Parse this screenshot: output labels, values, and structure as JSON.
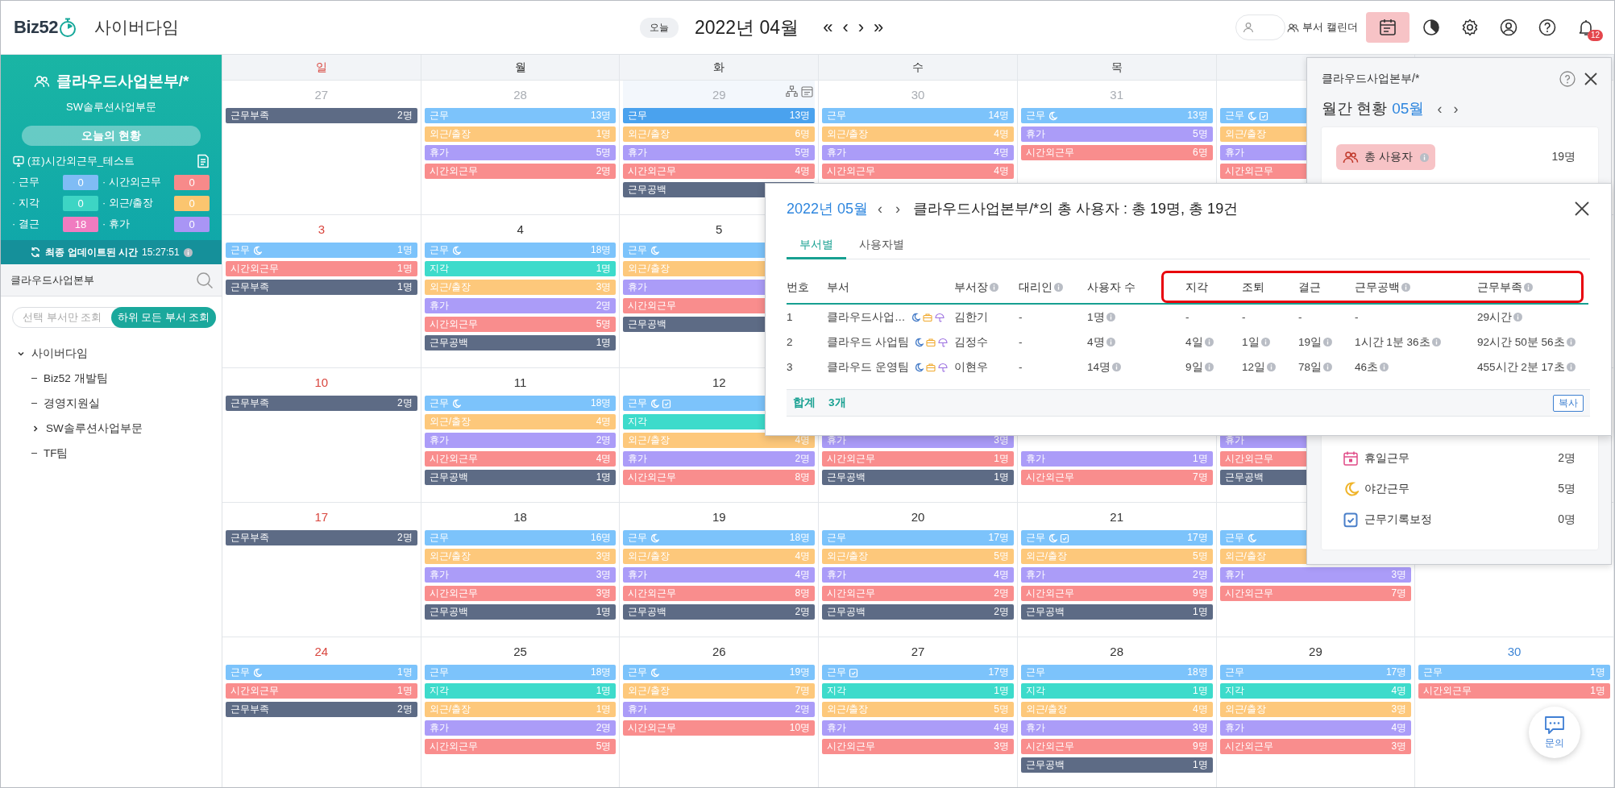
{
  "topbar": {
    "logo": "Biz52",
    "company": "사이버다임",
    "today_button": "오늘",
    "month_title": "2022년 04월",
    "nav": [
      "«",
      "‹",
      "›",
      "»"
    ],
    "calendar_toggle": "부서 캘린더",
    "tools": [
      {
        "kind": "calendar",
        "selected": true
      },
      {
        "kind": "chart",
        "selected": false
      },
      {
        "kind": "settings",
        "selected": false
      },
      {
        "kind": "account",
        "selected": false
      },
      {
        "kind": "help",
        "selected": false
      },
      {
        "kind": "notifications",
        "selected": false,
        "badge": "12"
      }
    ]
  },
  "sidebar": {
    "org_title": "클라우드사업본부/*",
    "org_subtitle": "SW솔루션사업부문",
    "today_label": "오늘의 현황",
    "report": "(표)시간외근무_테스트",
    "stats": [
      {
        "label": "· 근무",
        "value": "0",
        "color": "#7fbcf5"
      },
      {
        "label": "· 시간외근무",
        "value": "0",
        "color": "#f78a8a"
      },
      {
        "label": "· 지각",
        "value": "0",
        "color": "#3dd5c4"
      },
      {
        "label": "· 외근/출장",
        "value": "0",
        "color": "#fbc56f"
      },
      {
        "label": "· 결근",
        "value": "18",
        "color": "#f07cc0"
      },
      {
        "label": "· 휴가",
        "value": "0",
        "color": "#a995f5"
      }
    ],
    "update_label": "최종 업데이트된 시간",
    "update_time": "15:27:51",
    "search": {
      "value": "클라우드사업본부"
    },
    "scope": [
      {
        "label": "선택 부서만 조회",
        "selected": false
      },
      {
        "label": "하위 모든 부서 조회",
        "selected": true
      }
    ],
    "tree": [
      {
        "label": "사이버다임",
        "expanded": true,
        "children": [
          {
            "label": "Biz52 개발팀"
          },
          {
            "label": "경영지원실"
          },
          {
            "label": "SW솔루션사업부문",
            "expanded": false
          },
          {
            "label": "TF팀"
          }
        ]
      }
    ]
  },
  "calendar": {
    "weekdays": [
      {
        "label": "일",
        "kind": "sunday"
      },
      {
        "label": "월",
        "kind": "weekday"
      },
      {
        "label": "화",
        "kind": "weekday"
      },
      {
        "label": "수",
        "kind": "weekday"
      },
      {
        "label": "목",
        "kind": "weekday"
      },
      {
        "kind": "weekday"
      },
      {
        "kind": "saturday"
      }
    ],
    "weeks": [
      {
        "days": [
          {
            "day": "27",
            "other_month": true,
            "hovered": false,
            "events": [
              {
                "kind": "shortage",
                "label": "근무부족",
                "count": "2명"
              }
            ]
          },
          {
            "day": "28",
            "other_month": true,
            "hovered": false,
            "events": [
              {
                "kind": "work",
                "label": "근무",
                "count": "13명",
                "night": false,
                "corrected": false
              },
              {
                "kind": "outside",
                "label": "외근/출장",
                "count": "1명"
              },
              {
                "kind": "vacation",
                "label": "휴가",
                "count": "5명"
              },
              {
                "kind": "overtime",
                "label": "시간외근무",
                "count": "2명"
              }
            ]
          },
          {
            "day": "29",
            "other_month": true,
            "hovered": true,
            "events": [
              {
                "kind": "work",
                "label": "근무",
                "count": "13명",
                "night": false,
                "corrected": false
              },
              {
                "kind": "outside",
                "label": "외근/출장",
                "count": "6명"
              },
              {
                "kind": "vacation",
                "label": "휴가",
                "count": "5명"
              },
              {
                "kind": "overtime",
                "label": "시간외근무",
                "count": "4명"
              },
              {
                "kind": "gap",
                "label": "근무공백"
              }
            ]
          },
          {
            "day": "30",
            "other_month": true,
            "hovered": false,
            "events": [
              {
                "kind": "work",
                "label": "근무",
                "count": "14명",
                "night": false,
                "corrected": false
              },
              {
                "kind": "outside",
                "label": "외근/출장",
                "count": "4명"
              },
              {
                "kind": "vacation",
                "label": "휴가",
                "count": "4명"
              },
              {
                "kind": "overtime",
                "label": "시간외근무",
                "count": "4명"
              }
            ]
          },
          {
            "day": "31",
            "other_month": true,
            "hovered": false,
            "events": [
              {
                "kind": "work",
                "label": "근무",
                "count": "13명",
                "night": true,
                "corrected": false
              },
              {
                "kind": "vacation",
                "label": "휴가",
                "count": "5명"
              },
              {
                "kind": "overtime",
                "label": "시간외근무",
                "count": "6명"
              }
            ]
          },
          {
            "events": [
              {
                "kind": "work",
                "label": "근무",
                "night": true,
                "corrected": true
              },
              {
                "kind": "outside",
                "label": "외근/출장"
              },
              {
                "kind": "vacation",
                "label": "휴가"
              },
              {
                "kind": "overtime",
                "label": "시간외근무"
              }
            ]
          }
        ]
      },
      {
        "days": [
          {
            "day": "3",
            "other_month": false,
            "hovered": false,
            "events": [
              {
                "kind": "work",
                "label": "근무",
                "count": "1명",
                "night": true,
                "corrected": false
              },
              {
                "kind": "overtime",
                "label": "시간외근무",
                "count": "1명"
              },
              {
                "kind": "shortage",
                "label": "근무부족",
                "count": "1명"
              }
            ]
          },
          {
            "day": "4",
            "other_month": false,
            "hovered": false,
            "events": [
              {
                "kind": "work",
                "label": "근무",
                "count": "18명",
                "night": true,
                "corrected": false
              },
              {
                "kind": "late",
                "label": "지각",
                "count": "1명"
              },
              {
                "kind": "outside",
                "label": "외근/출장",
                "count": "3명"
              },
              {
                "kind": "vacation",
                "label": "휴가",
                "count": "2명"
              },
              {
                "kind": "overtime",
                "label": "시간외근무",
                "count": "5명"
              },
              {
                "kind": "gap",
                "label": "근무공백",
                "count": "1명"
              }
            ]
          },
          {
            "day": "5",
            "other_month": false,
            "hovered": false,
            "events": [
              {
                "kind": "work",
                "label": "근무",
                "night": true,
                "corrected": false
              },
              {
                "kind": "outside",
                "label": "외근/출장"
              },
              {
                "kind": "vacation",
                "label": "휴가"
              },
              {
                "kind": "overtime",
                "label": "시간외근무"
              },
              {
                "kind": "gap",
                "label": "근무공백"
              }
            ]
          }
        ]
      },
      {
        "days": [
          {
            "day": "10",
            "other_month": false,
            "hovered": false,
            "events": [
              {
                "kind": "shortage",
                "label": "근무부족",
                "count": "2명"
              }
            ]
          },
          {
            "day": "11",
            "other_month": false,
            "hovered": false,
            "events": [
              {
                "kind": "work",
                "label": "근무",
                "count": "18명",
                "night": true,
                "corrected": false
              },
              {
                "kind": "outside",
                "label": "외근/출장",
                "count": "4명"
              },
              {
                "kind": "vacation",
                "label": "휴가",
                "count": "2명"
              },
              {
                "kind": "overtime",
                "label": "시간외근무",
                "count": "4명"
              },
              {
                "kind": "gap",
                "label": "근무공백",
                "count": "1명"
              }
            ]
          },
          {
            "day": "12",
            "other_month": false,
            "hovered": false,
            "events": [
              {
                "kind": "work",
                "label": "근무",
                "night": true,
                "corrected": true
              },
              {
                "kind": "late",
                "label": "지각"
              },
              {
                "kind": "outside",
                "label": "외근/출장",
                "count": "4명"
              },
              {
                "kind": "vacation",
                "label": "휴가",
                "count": "2명"
              },
              {
                "kind": "overtime",
                "label": "시간외근무",
                "count": "8명"
              }
            ]
          },
          {
            "events": [
              {
                "kind": "vacation",
                "label": "휴가",
                "count": "3명"
              },
              {
                "kind": "overtime",
                "label": "시간외근무",
                "count": "1명"
              },
              {
                "kind": "gap",
                "label": "근무공백",
                "count": "1명"
              }
            ]
          },
          {
            "events": [
              {
                "kind": "vacation",
                "label": "휴가",
                "count": "1명"
              },
              {
                "kind": "overtime",
                "label": "시간외근무",
                "count": "7명"
              }
            ]
          },
          {
            "events": [
              {
                "kind": "vacation",
                "label": "휴가"
              },
              {
                "kind": "overtime",
                "label": "시간외근무"
              },
              {
                "kind": "gap",
                "label": "근무공백"
              }
            ]
          }
        ]
      },
      {
        "days": [
          {
            "day": "17",
            "other_month": false,
            "hovered": false,
            "events": [
              {
                "kind": "shortage",
                "label": "근무부족",
                "count": "2명"
              }
            ]
          },
          {
            "day": "18",
            "other_month": false,
            "hovered": false,
            "events": [
              {
                "kind": "work",
                "label": "근무",
                "count": "16명",
                "night": false,
                "corrected": false
              },
              {
                "kind": "outside",
                "label": "외근/출장",
                "count": "3명"
              },
              {
                "kind": "vacation",
                "label": "휴가",
                "count": "3명"
              },
              {
                "kind": "overtime",
                "label": "시간외근무",
                "count": "3명"
              },
              {
                "kind": "gap",
                "label": "근무공백",
                "count": "1명"
              }
            ]
          },
          {
            "day": "19",
            "other_month": false,
            "hovered": false,
            "events": [
              {
                "kind": "work",
                "label": "근무",
                "count": "18명",
                "night": true,
                "corrected": false
              },
              {
                "kind": "outside",
                "label": "외근/출장",
                "count": "4명"
              },
              {
                "kind": "vacation",
                "label": "휴가",
                "count": "4명"
              },
              {
                "kind": "overtime",
                "label": "시간외근무",
                "count": "8명"
              },
              {
                "kind": "gap",
                "label": "근무공백",
                "count": "2명"
              }
            ]
          },
          {
            "day": "20",
            "other_month": false,
            "hovered": false,
            "events": [
              {
                "kind": "work",
                "label": "근무",
                "count": "17명",
                "night": false,
                "corrected": false
              },
              {
                "kind": "outside",
                "label": "외근/출장",
                "count": "5명"
              },
              {
                "kind": "vacation",
                "label": "휴가",
                "count": "4명"
              },
              {
                "kind": "overtime",
                "label": "시간외근무",
                "count": "2명"
              },
              {
                "kind": "gap",
                "label": "근무공백",
                "count": "2명"
              }
            ]
          },
          {
            "day": "21",
            "other_month": false,
            "hovered": false,
            "events": [
              {
                "kind": "work",
                "label": "근무",
                "count": "17명",
                "night": true,
                "corrected": true
              },
              {
                "kind": "outside",
                "label": "외근/출장",
                "count": "5명"
              },
              {
                "kind": "vacation",
                "label": "휴가",
                "count": "2명"
              },
              {
                "kind": "overtime",
                "label": "시간외근무",
                "count": "9명"
              },
              {
                "kind": "gap",
                "label": "근무공백",
                "count": "1명"
              }
            ]
          },
          {
            "events": [
              {
                "kind": "work",
                "label": "근무",
                "night": true,
                "corrected": false
              },
              {
                "kind": "outside",
                "label": "외근/출장"
              },
              {
                "kind": "vacation",
                "label": "휴가",
                "count": "3명"
              },
              {
                "kind": "overtime",
                "label": "시간외근무",
                "count": "7명"
              }
            ]
          }
        ]
      },
      {
        "days": [
          {
            "day": "24",
            "other_month": false,
            "hovered": false,
            "events": [
              {
                "kind": "work",
                "label": "근무",
                "count": "1명",
                "night": true,
                "corrected": false
              },
              {
                "kind": "overtime",
                "label": "시간외근무",
                "count": "1명"
              },
              {
                "kind": "shortage",
                "label": "근무부족",
                "count": "2명"
              }
            ]
          },
          {
            "day": "25",
            "other_month": false,
            "hovered": false,
            "events": [
              {
                "kind": "work",
                "label": "근무",
                "count": "18명",
                "night": false,
                "corrected": false
              },
              {
                "kind": "late",
                "label": "지각",
                "count": "1명"
              },
              {
                "kind": "outside",
                "label": "외근/출장",
                "count": "1명"
              },
              {
                "kind": "vacation",
                "label": "휴가",
                "count": "2명"
              },
              {
                "kind": "overtime",
                "label": "시간외근무",
                "count": "5명"
              }
            ]
          },
          {
            "day": "26",
            "other_month": false,
            "hovered": false,
            "events": [
              {
                "kind": "work",
                "label": "근무",
                "count": "19명",
                "night": true,
                "corrected": false
              },
              {
                "kind": "outside",
                "label": "외근/출장",
                "count": "7명"
              },
              {
                "kind": "vacation",
                "label": "휴가",
                "count": "2명"
              },
              {
                "kind": "overtime",
                "label": "시간외근무",
                "count": "10명"
              }
            ]
          },
          {
            "day": "27",
            "other_month": false,
            "hovered": false,
            "events": [
              {
                "kind": "work",
                "label": "근무",
                "count": "17명",
                "night": false,
                "corrected": true
              },
              {
                "kind": "late",
                "label": "지각",
                "count": "1명"
              },
              {
                "kind": "outside",
                "label": "외근/출장",
                "count": "5명"
              },
              {
                "kind": "vacation",
                "label": "휴가",
                "count": "4명"
              },
              {
                "kind": "overtime",
                "label": "시간외근무",
                "count": "3명"
              }
            ]
          },
          {
            "day": "28",
            "other_month": false,
            "hovered": false,
            "events": [
              {
                "kind": "work",
                "label": "근무",
                "count": "18명",
                "night": false,
                "corrected": false
              },
              {
                "kind": "late",
                "label": "지각",
                "count": "1명"
              },
              {
                "kind": "outside",
                "label": "외근/출장",
                "count": "4명"
              },
              {
                "kind": "vacation",
                "label": "휴가",
                "count": "3명"
              },
              {
                "kind": "overtime",
                "label": "시간외근무",
                "count": "9명"
              },
              {
                "kind": "gap",
                "label": "근무공백",
                "count": "1명"
              }
            ]
          },
          {
            "day": "29",
            "other_month": false,
            "hovered": false,
            "events": [
              {
                "kind": "work",
                "label": "근무",
                "count": "17명",
                "night": false,
                "corrected": false
              },
              {
                "kind": "late",
                "label": "지각",
                "count": "4명"
              },
              {
                "kind": "outside",
                "label": "외근/출장",
                "count": "3명"
              },
              {
                "kind": "vacation",
                "label": "휴가",
                "count": "4명"
              },
              {
                "kind": "overtime",
                "label": "시간외근무",
                "count": "3명"
              }
            ]
          },
          {
            "day": "30",
            "other_month": false,
            "hovered": false,
            "events": [
              {
                "kind": "work",
                "label": "근무",
                "count": "1명",
                "night": false,
                "corrected": false
              },
              {
                "kind": "overtime",
                "label": "시간외근무",
                "count": "1명"
              }
            ]
          }
        ]
      }
    ]
  },
  "summary_panel": {
    "title": "클라우드사업본부/*",
    "heading": "월간 현황",
    "month": "05월",
    "nav": [
      "‹",
      "›"
    ],
    "top_rows": [
      {
        "kind": "users",
        "label": "총 사용자",
        "value": "19명",
        "selected": true,
        "info": true
      }
    ],
    "bottom_rows": [
      {
        "kind": "holiday",
        "label": "휴일근무",
        "value": "2명",
        "selected": false,
        "info": false
      },
      {
        "kind": "night",
        "label": "야간근무",
        "value": "5명",
        "selected": false,
        "info": false
      },
      {
        "kind": "correction",
        "label": "근무기록보정",
        "value": "0명",
        "selected": false,
        "info": false
      }
    ]
  },
  "modal": {
    "month": "2022년 05월",
    "nav": [
      "‹",
      "›"
    ],
    "title": "클라우드사업본부/*의 총 사용자 : 총 19명, 총 19건",
    "tabs": [
      {
        "label": "부서별",
        "selected": true
      },
      {
        "label": "사용자별",
        "selected": false
      }
    ],
    "columns": [
      {
        "label": "번호",
        "info": false
      },
      {
        "label": "부서",
        "info": false
      },
      {
        "label": "부서장",
        "info": true
      },
      {
        "label": "대리인",
        "info": true
      },
      {
        "label": "사용자 수",
        "info": false
      }
    ],
    "highlighted_columns": [
      {
        "label": "지각",
        "info": false
      },
      {
        "label": "조퇴",
        "info": false
      },
      {
        "label": "결근",
        "info": false
      },
      {
        "label": "근무공백",
        "info": true
      },
      {
        "label": "근무부족",
        "info": true
      }
    ],
    "rows": [
      {
        "cells": [
          {
            "text": "1",
            "info": false
          },
          {
            "text": "클라우드사업…",
            "kind": "dept",
            "info": false
          },
          {
            "text": "김한기",
            "info": false
          },
          {
            "text": "-",
            "info": false
          },
          {
            "text": "1명",
            "info": true
          },
          {
            "text": "-",
            "info": false
          },
          {
            "text": "-",
            "info": false
          },
          {
            "text": "-",
            "info": false
          },
          {
            "text": "-",
            "info": false
          },
          {
            "text": "29시간",
            "info": true
          }
        ]
      },
      {
        "cells": [
          {
            "text": "2",
            "info": false
          },
          {
            "text": "클라우드 사업팀",
            "kind": "dept",
            "info": false
          },
          {
            "text": "김정수",
            "info": false
          },
          {
            "text": "-",
            "info": false
          },
          {
            "text": "4명",
            "info": true
          },
          {
            "text": "4일",
            "info": true
          },
          {
            "text": "1일",
            "info": true
          },
          {
            "text": "19일",
            "info": true
          },
          {
            "text": "1시간 1분 36초",
            "info": true
          },
          {
            "text": "92시간 50분 56초",
            "info": true
          }
        ]
      },
      {
        "cells": [
          {
            "text": "3",
            "info": false
          },
          {
            "text": "클라우드 운영팀",
            "kind": "dept",
            "info": false
          },
          {
            "text": "이현우",
            "info": false
          },
          {
            "text": "-",
            "info": false
          },
          {
            "text": "14명",
            "info": true
          },
          {
            "text": "9일",
            "info": true
          },
          {
            "text": "12일",
            "info": true
          },
          {
            "text": "78일",
            "info": true
          },
          {
            "text": "46초",
            "info": true
          },
          {
            "text": "455시간 2분 17초",
            "info": true
          }
        ]
      }
    ],
    "footer": {
      "label": "합계",
      "count": "3개",
      "copy_button": "복사"
    }
  },
  "chat_button": "문의"
}
